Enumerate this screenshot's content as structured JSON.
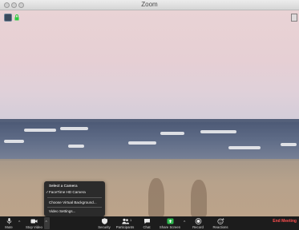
{
  "window": {
    "title": "Zoom"
  },
  "camera_menu": {
    "header": "Select a Camera",
    "options": [
      {
        "label": "FaceTime HD Camera",
        "checked": true
      },
      {
        "label": "Choose Virtual Background..."
      },
      {
        "label": "Video Settings..."
      }
    ],
    "check_glyph": "✓"
  },
  "toolbar": {
    "mute": "Mute",
    "stop_video": "Stop Video",
    "security": "Security",
    "participants": "Participants",
    "participants_count": "1",
    "chat": "Chat",
    "share_screen": "Share Screen",
    "record": "Record",
    "reactions": "Reactions",
    "end_meeting": "End Meeting"
  },
  "colors": {
    "toolbar_bg": "#1c1c1c",
    "share_green": "#2db84d",
    "end_red": "#ff4f4f"
  }
}
